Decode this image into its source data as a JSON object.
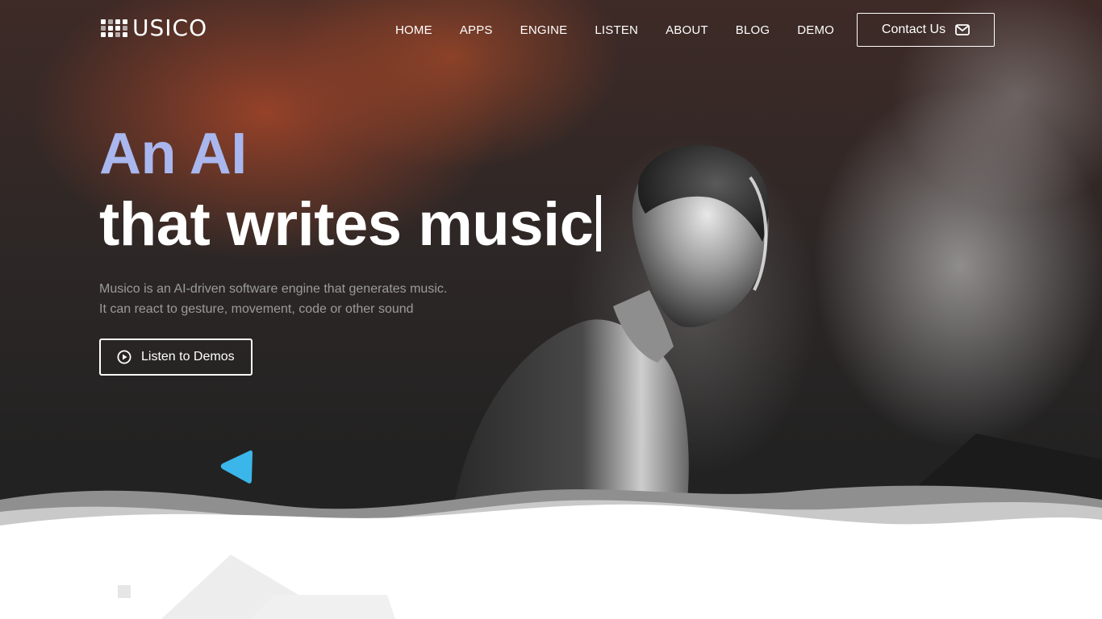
{
  "brand": {
    "logo_text": "USICO"
  },
  "nav": {
    "items": [
      {
        "label": "HOME"
      },
      {
        "label": "APPS"
      },
      {
        "label": "ENGINE"
      },
      {
        "label": "LISTEN"
      },
      {
        "label": "ABOUT"
      },
      {
        "label": "BLOG"
      },
      {
        "label": "DEMO"
      }
    ],
    "contact_label": "Contact Us",
    "contact_icon": "envelope-icon"
  },
  "hero": {
    "headline_1": "An AI",
    "headline_2": "that writes music",
    "subtitle_1": "Musico is an AI-driven software engine that generates music.",
    "subtitle_2": "It can react to gesture, movement, code or other sound",
    "cta_label": "Listen to Demos",
    "cta_icon": "play-circle-icon"
  },
  "colors": {
    "accent_headline": "#a9b7ee",
    "triangle": "#3bb6ea",
    "background_dark": "#232323"
  }
}
